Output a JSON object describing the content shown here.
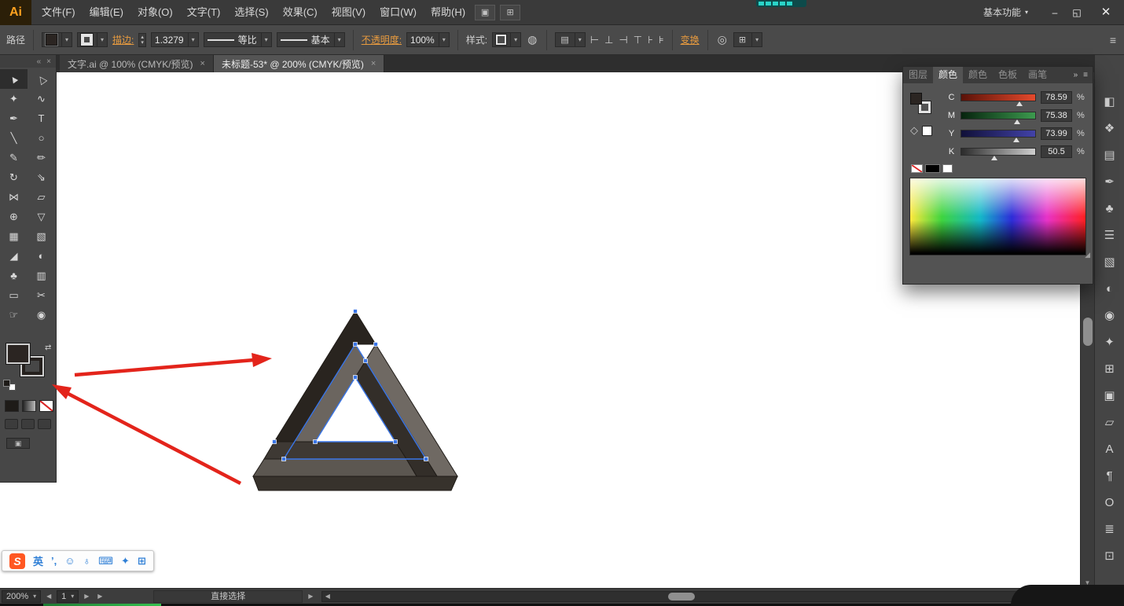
{
  "window": {
    "logo": "Ai",
    "workspace": "基本功能",
    "minimize": "–",
    "restore": "◱",
    "close": "✕"
  },
  "menubar": {
    "items": [
      {
        "label": "文件(F)"
      },
      {
        "label": "编辑(E)"
      },
      {
        "label": "对象(O)"
      },
      {
        "label": "文字(T)"
      },
      {
        "label": "选择(S)"
      },
      {
        "label": "效果(C)"
      },
      {
        "label": "视图(V)"
      },
      {
        "label": "窗口(W)"
      },
      {
        "label": "帮助(H)"
      }
    ]
  },
  "icons": {
    "dd": "▾",
    "close": "×",
    "collapse": "«",
    "expand": "»",
    "menu": "≡",
    "prev": "◀",
    "next": "▶",
    "up": "▲",
    "down": "▼",
    "spin_up": "▴",
    "spin_down": "▾",
    "globe": "◍",
    "target": "◎",
    "board": "▤",
    "arrange": "▣",
    "grid": "⊞",
    "swap": "⇄",
    "resize": "◢",
    "dots": "⠿"
  },
  "controlbar": {
    "target_label": "路径",
    "stroke_label": "描边:",
    "stroke_value": "1.3279",
    "profile_value": "等比",
    "brush_value": "基本",
    "opacity_label": "不透明度:",
    "opacity_value": "100%",
    "style_label": "样式:",
    "transform_label": "变换",
    "align_icons": [
      "⊢",
      "⊥",
      "⊣",
      "⊤",
      "⊦",
      "⊧"
    ]
  },
  "tabs": [
    {
      "title": "文字.ai @ 100% (CMYK/预览)"
    },
    {
      "title": "未标题-53* @ 200% (CMYK/预览)"
    }
  ],
  "toolbar": {
    "tools": [
      "▲",
      "△",
      "✦",
      "∿",
      "✒",
      "T",
      "╲",
      "○",
      "✎",
      "✏",
      "↻",
      "⇘",
      "⋈",
      "▱",
      "⊕",
      "▽",
      "▦",
      "▧",
      "◢",
      "◐",
      "♣",
      "▥",
      "▭",
      "✂",
      "☞",
      "◉"
    ]
  },
  "color_panel": {
    "tabs": [
      "图层",
      "颜色",
      "颜色",
      "色板",
      "画笔"
    ],
    "sliders": [
      {
        "channel": "C",
        "value": "78.59",
        "unit": "%"
      },
      {
        "channel": "M",
        "value": "75.38",
        "unit": "%"
      },
      {
        "channel": "Y",
        "value": "73.99",
        "unit": "%"
      },
      {
        "channel": "K",
        "value": "50.5",
        "unit": "%"
      }
    ]
  },
  "dock": {
    "items": [
      "◧",
      "❖",
      "▤",
      "✒",
      "♣",
      "☰",
      "▧",
      "◐",
      "◉",
      "✦",
      "⊞",
      "▣",
      "▱",
      "A",
      "¶",
      "O",
      "≣",
      "⊡"
    ]
  },
  "statusbar": {
    "zoom": "200%",
    "artboard": "1",
    "tool_label": "直接选择"
  },
  "ime": {
    "logo": "S",
    "items": [
      "英",
      "’,",
      "☺",
      "♁",
      "⌨",
      "✦",
      "⊞"
    ]
  },
  "colors": {
    "fill_swatch": "#2b2522",
    "annotation_arrow": "#e3241b",
    "selection_blue": "#3a76e8",
    "canvas": "#ffffff"
  }
}
